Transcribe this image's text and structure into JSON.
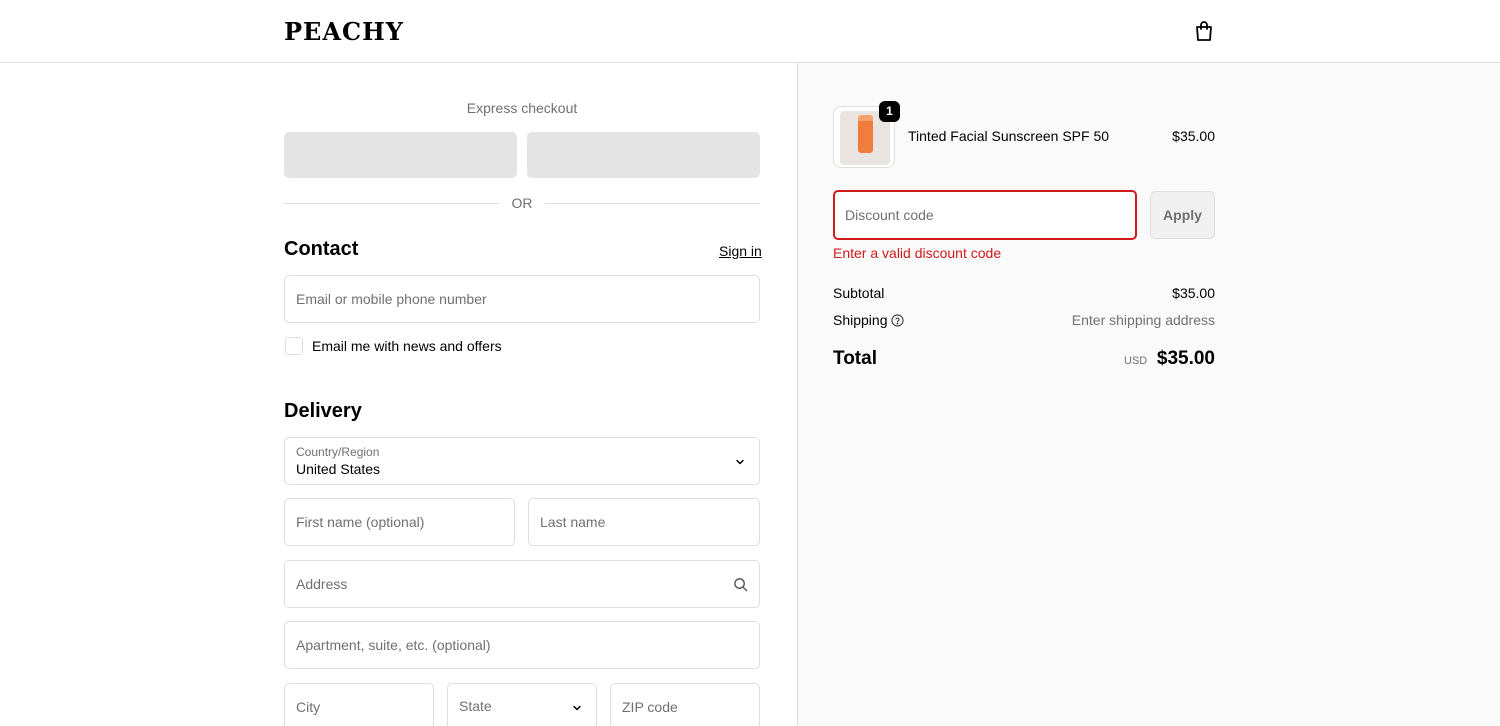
{
  "header": {
    "logo": "PEACHY",
    "cart_icon": "shopping-bag-icon"
  },
  "express": {
    "title": "Express checkout",
    "divider": "OR"
  },
  "contact": {
    "title": "Contact",
    "sign_in": "Sign in",
    "email_placeholder": "Email or mobile phone number",
    "newsletter_label": "Email me with news and offers",
    "newsletter_checked": false
  },
  "delivery": {
    "title": "Delivery",
    "country_label": "Country/Region",
    "country_value": "United States",
    "first_name_placeholder": "First name (optional)",
    "last_name_placeholder": "Last name",
    "address_placeholder": "Address",
    "apartment_placeholder": "Apartment, suite, etc. (optional)",
    "city_placeholder": "City",
    "state_placeholder": "State",
    "zip_placeholder": "ZIP code"
  },
  "summary": {
    "product": {
      "name": "Tinted Facial Sunscreen SPF 50",
      "price": "$35.00",
      "quantity": "1"
    },
    "discount_placeholder": "Discount code",
    "apply_label": "Apply",
    "discount_error": "Enter a valid discount code",
    "subtotal_label": "Subtotal",
    "subtotal_value": "$35.00",
    "shipping_label": "Shipping",
    "shipping_value": "Enter shipping address",
    "total_label": "Total",
    "currency": "USD",
    "total_value": "$35.00"
  },
  "colors": {
    "error": "#d11a1a",
    "border": "#dedede",
    "muted_text": "#707070",
    "summary_bg": "#fafafa"
  }
}
